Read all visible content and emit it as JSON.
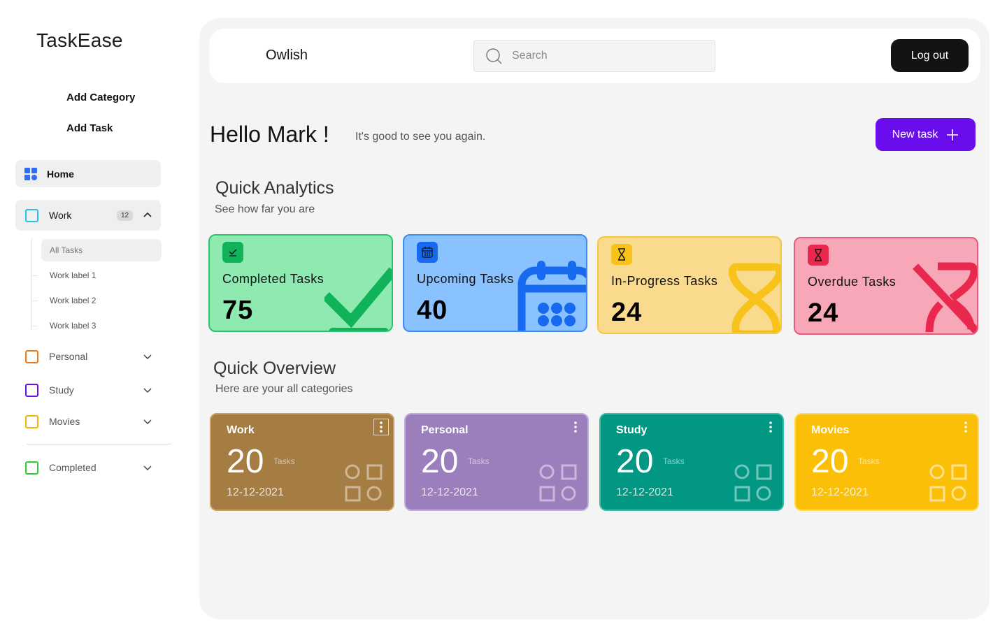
{
  "app": {
    "brand": "TaskEase",
    "workspace": "Owlish"
  },
  "sidebar": {
    "actions": {
      "add_category": "Add Category",
      "add_task": "Add Task"
    },
    "home_label": "Home",
    "work": {
      "label": "Work",
      "count": "12",
      "color": "#24c1e8",
      "sub_items": [
        "All Tasks",
        "Work label  1",
        "Work label  2",
        "Work label  3"
      ]
    },
    "categories": [
      {
        "label": "Personal",
        "color": "#ef7b18"
      },
      {
        "label": "Study",
        "color": "#6a10e6"
      },
      {
        "label": "Movies",
        "color": "#f5b400"
      }
    ],
    "completed": {
      "label": "Completed",
      "color": "#25d32a"
    }
  },
  "header": {
    "search_placeholder": "Search",
    "logout_label": "Log out"
  },
  "greeting": {
    "title": "Hello Mark  !",
    "subtitle": "It's good to see you again.",
    "new_task_label": "New task"
  },
  "analytics": {
    "title": "Quick Analytics",
    "subtitle": "See how far you are",
    "cards": [
      {
        "title": "Completed Tasks",
        "value": "75",
        "bg": "#8eeab0",
        "border": "#2fc36b",
        "accent": "#10b25a",
        "icon": "check-icon"
      },
      {
        "title": "Upcoming Tasks",
        "value": "40",
        "bg": "#8ac2ff",
        "border": "#3c8df2",
        "accent": "#1769ef",
        "icon": "calendar-icon"
      },
      {
        "title": "In-Progress Tasks",
        "value": "24",
        "bg": "#fadb8e",
        "border": "#f6c640",
        "accent": "#f7c31a",
        "icon": "hourglass-icon"
      },
      {
        "title": "Overdue Tasks",
        "value": "24",
        "bg": "#f8a7b8",
        "border": "#e85a7a",
        "accent": "#e8294d",
        "icon": "hourglass-off-icon"
      }
    ]
  },
  "overview": {
    "title": "Quick Overview",
    "subtitle": "Here are your all categories",
    "tasks_word": "Tasks",
    "cards": [
      {
        "name": "Work",
        "count": "20",
        "date": "12-12-2021",
        "bg": "#a57c41",
        "border": "#c79f63"
      },
      {
        "name": "Personal",
        "count": "20",
        "date": "12-12-2021",
        "bg": "#9b7fbd",
        "border": "#c2aede"
      },
      {
        "name": "Study",
        "count": "20",
        "date": "12-12-2021",
        "bg": "#019783",
        "border": "#37bfa8"
      },
      {
        "name": "Movies",
        "count": "20",
        "date": "12-12-2021",
        "bg": "#fcbf07",
        "border": "#ffd95a"
      }
    ]
  }
}
